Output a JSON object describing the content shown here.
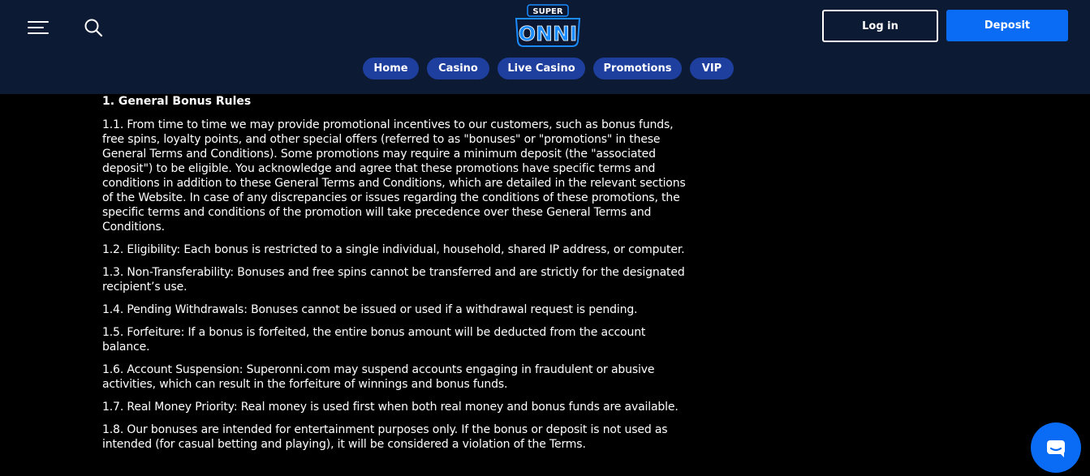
{
  "header": {
    "logo_text_top": "SUPER",
    "logo_text_main": "ONNI",
    "login_label": "Log in",
    "deposit_label": "Deposit",
    "colors": {
      "header_bg": "#0d1a33",
      "nav_pill": "#1e3f9e",
      "deposit": "#0a6cf5",
      "logo_blue": "#1a8cff"
    },
    "icons": {
      "menu": "hamburger-menu-icon",
      "search": "search-icon",
      "chat": "chat-bubble-icon"
    }
  },
  "nav": {
    "items": [
      {
        "label": "Home"
      },
      {
        "label": "Casino"
      },
      {
        "label": "Live Casino"
      },
      {
        "label": "Promotions"
      },
      {
        "label": "VIP"
      }
    ]
  },
  "content": {
    "heading": "1. General Bonus Rules",
    "paragraphs": [
      "1.1. From time to time we may provide promotional incentives to our customers, such as bonus funds, free spins, loyalty points, and other special offers (referred to as \"bonuses\" or \"promotions\" in these General Terms and Conditions). Some promotions may require a minimum deposit (the \"associated deposit\") to be eligible. You acknowledge and agree that these promotions have specific terms and conditions in addition to these General Terms and Conditions, which are detailed in the relevant sections of the Website. In case of any discrepancies or issues regarding the conditions of these promotions, the specific terms and conditions of the promotion will take precedence over these General Terms and Conditions.",
      "1.2. Eligibility: Each bonus is restricted to a single individual, household, shared IP address, or computer.",
      "1.3. Non-Transferability: Bonuses and free spins cannot be transferred and are strictly for the designated recipient’s use.",
      "1.4. Pending Withdrawals: Bonuses cannot be issued or used if a withdrawal request is pending.",
      "1.5. Forfeiture: If a bonus is forfeited, the entire bonus amount will be deducted from the account balance.",
      "1.6. Account Suspension: Superonni.com may suspend accounts engaging in fraudulent or abusive activities, which can result in the forfeiture of winnings and bonus funds.",
      "1.7. Real Money Priority: Real money is used first when both real money and bonus funds are available.",
      "1.8. Our bonuses are intended for entertainment purposes only. If the bonus or deposit is not used as intended (for casual betting and playing), it will be considered a violation of the Terms."
    ]
  }
}
